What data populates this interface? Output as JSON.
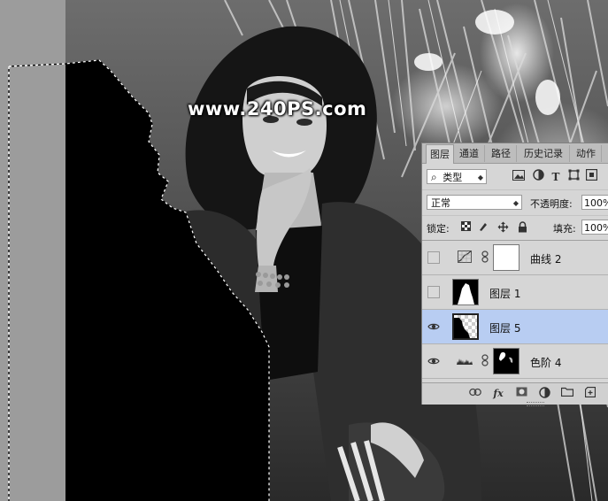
{
  "watermark": "www.240PS.com",
  "panel": {
    "tabs": [
      {
        "label": "图层",
        "active": true
      },
      {
        "label": "通道",
        "active": false
      },
      {
        "label": "路径",
        "active": false
      },
      {
        "label": "历史记录",
        "active": false
      },
      {
        "label": "动作",
        "active": false
      }
    ],
    "filter": {
      "search_glyph": "⌕",
      "value": "类型",
      "icons": [
        "image-filter-icon",
        "adjustment-filter-icon",
        "type-filter-icon",
        "shape-filter-icon",
        "smart-object-filter-icon"
      ]
    },
    "blend": {
      "mode": "正常",
      "opacity_label": "不透明度:",
      "opacity_value": "100%"
    },
    "lock": {
      "label": "锁定:",
      "fill_label": "填充:",
      "fill_value": "100%"
    },
    "layers": [
      {
        "name": "曲线 2",
        "visible": false,
        "type": "curves-adjustment",
        "selected": false
      },
      {
        "name": "图层 1",
        "visible": false,
        "type": "pixel",
        "selected": false
      },
      {
        "name": "图层 5",
        "visible": true,
        "type": "pixel",
        "selected": true
      },
      {
        "name": "色阶 4",
        "visible": true,
        "type": "levels-adjustment",
        "selected": false
      }
    ],
    "bottom_icons": [
      "link-layers-icon",
      "fx-icon",
      "add-mask-icon",
      "new-adjustment-icon",
      "new-group-icon",
      "new-layer-icon"
    ],
    "colors": {
      "panel_bg": "#d6d6d6",
      "selected_row": "#b8cdf2"
    }
  }
}
